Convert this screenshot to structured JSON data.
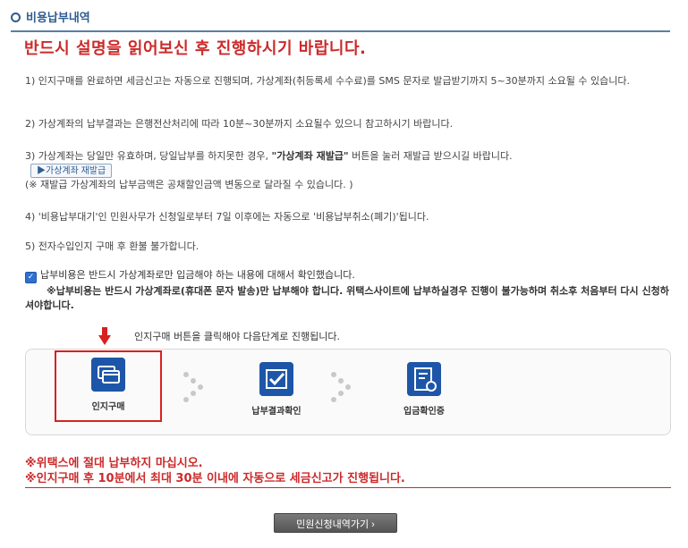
{
  "header": {
    "title": "비용납부내역"
  },
  "headline": "반드시 설명을 읽어보신 후 진행하시기 바랍니다.",
  "notes": {
    "n1": "1) 인지구매를 완료하면 세금신고는 자동으로 진행되며, 가상계좌(취등록세 수수료)를 SMS 문자로 발급받기까지 5~30분까지 소요될 수 있습니다.",
    "n2": "2) 가상계좌의 납부결과는 은행전산처리에 따라 10분~30분까지 소요될수 있으니 참고하시기 바랍니다.",
    "n3_pre": "3) 가상계좌는 당일만 유효하며, 당일납부를 하지못한 경우, ",
    "n3_strong": "\"가상계좌 재발급\"",
    "n3_post": " 버튼을 눌러 재발급 받으시길 바랍니다.",
    "n3_sub": "(※ 재발급 가상계좌의 납부금액은 공채할인금액 변동으로 달라질 수 있습니다. )",
    "n4": "4) '비용납부대기'인 민원사무가 신청일로부터 7일 이후에는 자동으로 '비용납부취소(폐기)'됩니다.",
    "n5": "5) 전자수입인지 구매 후 환불 불가합니다."
  },
  "reissue_button": "▶가상계좌 재발급",
  "confirm": {
    "check_glyph": "✓",
    "line1": "납부비용은 반드시 가상계좌로만 입금해야 하는 내용에 대해서 확인했습니다.",
    "line2": "※납부비용는 반드시 가상계좌로(휴대폰 문자 발송)만 납부해야 합니다. 위택스사이트에 납부하실경우 진행이 불가능하며 취소후 처음부터 다시 신청하셔야합니다."
  },
  "guide_text": "인지구매 버튼을 클릭해야 다음단계로 진행됩니다.",
  "steps": [
    {
      "label": "인지구매"
    },
    {
      "label": "납부결과확인"
    },
    {
      "label": "입금확인증"
    }
  ],
  "warnings": {
    "w1": "※위택스에 절대 납부하지 마십시오.",
    "w2": "※인지구매 후 10분에서 최대 30분 이내에 자동으로 세금신고가 진행됩니다."
  },
  "go_button": "민원신청내역가기 ›",
  "colors": {
    "accent_blue": "#2f5d90",
    "headline_red": "#cc2a2a",
    "icon_blue": "#1d56a8"
  }
}
